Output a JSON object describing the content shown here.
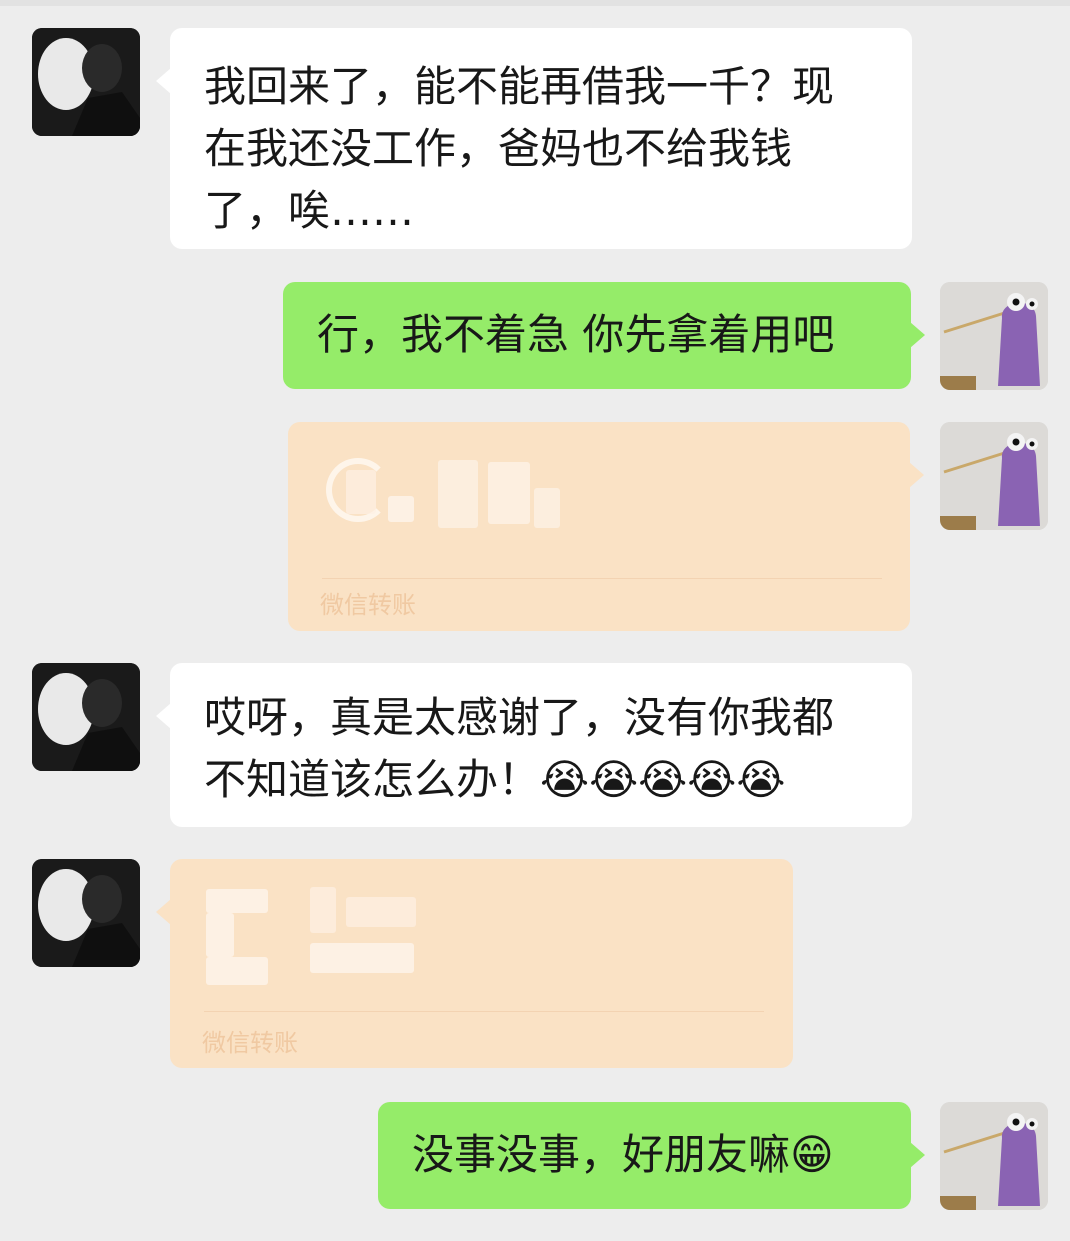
{
  "messages": [
    {
      "side": "friend",
      "type": "text",
      "text": "我回来了，能不能再借我一千？现\n在我还没工作，爸妈也不给我钱\n了，唉……"
    },
    {
      "side": "me",
      "type": "text",
      "text": "行，我不着急 你先拿着用吧"
    },
    {
      "side": "me",
      "type": "transfer",
      "label": "微信转账"
    },
    {
      "side": "friend",
      "type": "text",
      "text": "哎呀，真是太感谢了，没有你我都\n不知道该怎么办！",
      "emoji": "😭😭😭😭😭"
    },
    {
      "side": "friend",
      "type": "transfer",
      "label": "微信转账"
    },
    {
      "side": "me",
      "type": "text",
      "text": "没事没事，好朋友嘛",
      "emoji": "😁"
    }
  ],
  "colors": {
    "background": "#ededed",
    "bubble_me": "#95ec69",
    "bubble_friend": "#ffffff",
    "transfer": "#fae2c5"
  },
  "icons": {
    "friend_avatar": "dark-portrait-avatar",
    "me_avatar": "purple-figure-avatar"
  }
}
